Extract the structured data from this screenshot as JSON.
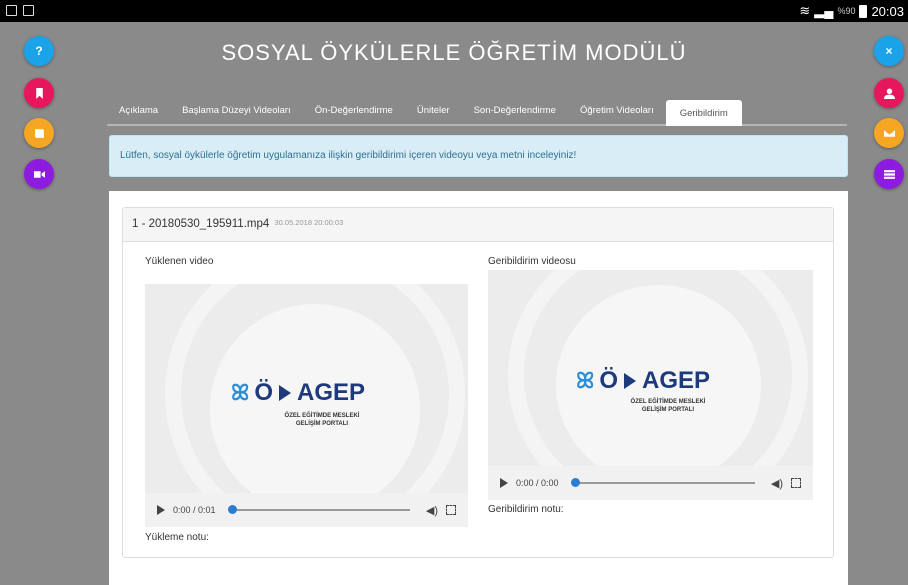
{
  "statusbar": {
    "signal_text": "%90",
    "time": "20:03"
  },
  "title": "SOSYAL ÖYKÜLERLE ÖĞRETİM MODÜLÜ",
  "tabs": [
    {
      "label": "Açıklama"
    },
    {
      "label": "Başlama Düzeyi Videoları"
    },
    {
      "label": "Ön-Değerlendirme"
    },
    {
      "label": "Üniteler"
    },
    {
      "label": "Son-Değerlendirme"
    },
    {
      "label": "Öğretim Videoları"
    },
    {
      "label": "Geribildirim"
    }
  ],
  "alert": "Lütfen, sosyal öykülerle öğretim uygulamanıza ilişkin geribildirimi içeren videoyu veya metni inceleyiniz!",
  "panel": {
    "filename": "1 - 20180530_195911.mp4",
    "date": "30.05.2018 20:00:03",
    "left_label": "Yüklenen video",
    "right_label": "Geribildirim videosu",
    "left_time": "0:00 / 0:01",
    "right_time": "0:00 / 0:00",
    "upload_note": "Yükleme notu:",
    "feedback_note": "Geribildirim notu:"
  },
  "logo": {
    "word": "AGEP",
    "prefix": "Ö",
    "sub1": "ÖZEL EĞİTİMDE MESLEKİ",
    "sub2": "GELİŞİM PORTALI"
  },
  "fabs_left": [
    {
      "icon": "question-icon",
      "color": "#1aa3e8"
    },
    {
      "icon": "bookmark-icon",
      "color": "#e8175d"
    },
    {
      "icon": "book-icon",
      "color": "#f5a623"
    },
    {
      "icon": "video-camera-icon",
      "color": "#8e1be0"
    }
  ],
  "fabs_right": [
    {
      "icon": "close-icon",
      "color": "#1aa3e8"
    },
    {
      "icon": "user-icon",
      "color": "#e8175d"
    },
    {
      "icon": "envelope-icon",
      "color": "#f5a623"
    },
    {
      "icon": "list-icon",
      "color": "#8e1be0"
    }
  ]
}
